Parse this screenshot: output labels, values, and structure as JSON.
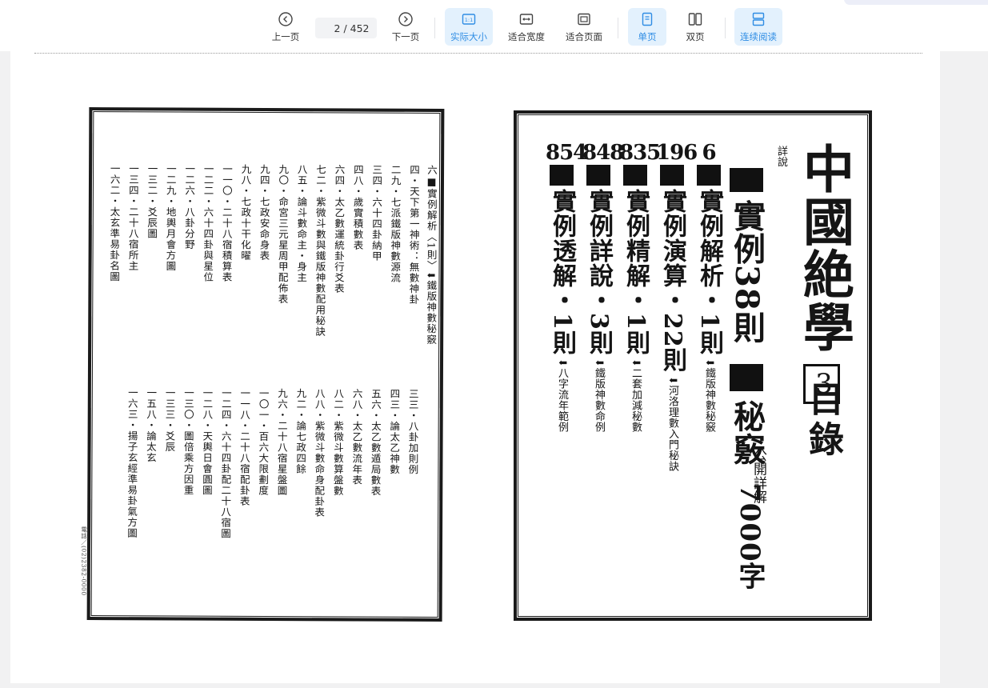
{
  "toolbar": {
    "prev_label": "上一页",
    "next_label": "下一页",
    "page_current": "2",
    "page_total": "/ 452",
    "actual_size_label": "实际大小",
    "fit_width_label": "适合宽度",
    "fit_page_label": "适合页面",
    "single_page_label": "单页",
    "double_page_label": "双页",
    "continuous_label": "连续阅读",
    "active_color": "#2f8de4"
  },
  "right_page": {
    "title": "中國絶學",
    "volume": "3",
    "heading": "目錄",
    "detail_label": "詳說",
    "cases_line": "實例38則",
    "secret_line": "秘竅",
    "secret_sub": "公開詳解",
    "secret_count": "7000字",
    "items": [
      {
        "page": "6",
        "title": "實例解析・1則",
        "note": "⬇鐵版神數秘竅"
      },
      {
        "page": "196",
        "title": "實例演算・22則",
        "note": "⬇河洛理數入門秘訣"
      },
      {
        "page": "835",
        "title": "實例精解・1則",
        "note": "⬇二套加減秘數"
      },
      {
        "page": "848",
        "title": "實例詳說・3則",
        "note": "⬇鐵版神數命例"
      },
      {
        "page": "854",
        "title": "實例透解・1則",
        "note": "⬇八字流年範例"
      }
    ]
  },
  "left_page": {
    "header": "六■實例解析〈1則〉⬇鐵版神數秘竅",
    "upper": [
      "四・天下第一神術：無數神卦",
      "二九・七派鐵版神數源流",
      "三四・六十四卦納甲",
      "四八・歲實積數表",
      "六四・太乙數運統卦行爻表",
      "七二・紫微斗數與鐵版神數配用秘訣",
      "八五・論斗數命主・身主",
      "九〇・命宮三元星周甲配佈表",
      "九四・七政安命身表",
      "九八・七政十干化曜",
      "一一〇・二十八宿積算表",
      "一二二・六十四卦與星位",
      "一二六・八卦分野",
      "一二九・地輿月會方圖",
      "一三二・爻辰圖",
      "一三四・二十八宿所主",
      "一六二・太玄準易卦名圖"
    ],
    "lower": [
      "三三・八卦加則例",
      "四三・論太乙神數",
      "五六・太乙數遁局數表",
      "六八・太乙數流年表",
      "八二・紫微斗數算盤數",
      "八八・紫微斗數命身配卦表",
      "九二・論七政四餘",
      "九六・二十八宿星盤圖",
      "一〇一・百六大限劃度",
      "一一八・二十八宿配卦表",
      "一二四・六十四卦配二十八宿圖",
      "一二八・天輿日會圓圖",
      "一三〇・圖倍乘方因重",
      "一三三・爻辰",
      "一五八・論太玄",
      "一六三・揚子玄經準易卦氣方圖"
    ],
    "credit": "電話／(02)2382-0000"
  }
}
